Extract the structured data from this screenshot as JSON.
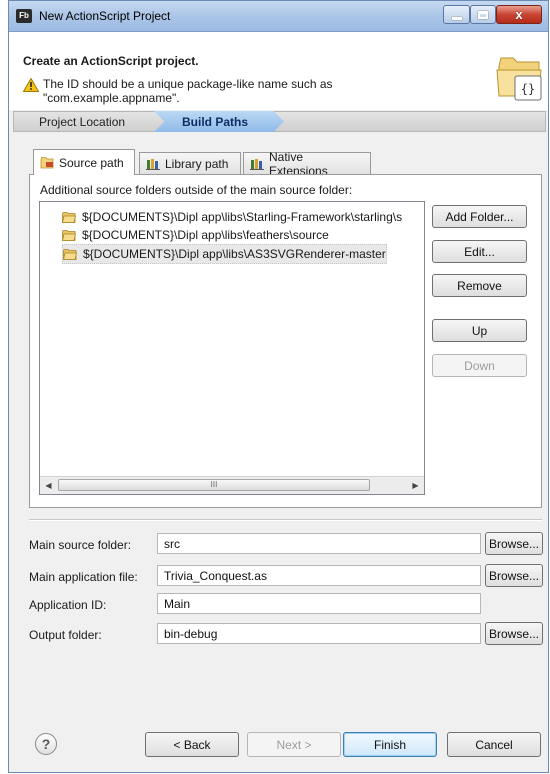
{
  "window": {
    "app_badge": "Fb",
    "title": "New ActionScript Project",
    "close_glyph": "x"
  },
  "header": {
    "title": "Create an ActionScript project.",
    "message": "The ID should be a unique package-like name such as \"com.example.appname\".",
    "banner_glyph": "{}"
  },
  "breadcrumb": {
    "items": [
      {
        "label": "Project Location"
      },
      {
        "label": "Build Paths"
      }
    ],
    "active_index": 1
  },
  "tabs": [
    {
      "label": "Source path",
      "icon": "source-path-icon"
    },
    {
      "label": "Library path",
      "icon": "library-icon"
    },
    {
      "label": "Native Extensions",
      "icon": "native-extension-icon"
    }
  ],
  "source_panel": {
    "label": "Additional source folders outside of the main source folder:",
    "folders": [
      {
        "path": "${DOCUMENTS}\\Dipl app\\libs\\Starling-Framework\\starling\\s"
      },
      {
        "path": "${DOCUMENTS}\\Dipl app\\libs\\feathers\\source"
      },
      {
        "path": "${DOCUMENTS}\\Dipl app\\libs\\AS3SVGRenderer-master"
      }
    ],
    "selected_index": 2,
    "scroll_thumb_grip": "III",
    "buttons": {
      "add_folder": "Add Folder...",
      "edit": "Edit...",
      "remove": "Remove",
      "up": "Up",
      "down": "Down"
    }
  },
  "form": {
    "main_source_folder": {
      "label": "Main source folder:",
      "value": "src"
    },
    "main_application_file": {
      "label": "Main application file:",
      "value": "Trivia_Conquest.as"
    },
    "application_id": {
      "label": "Application ID:",
      "value": "Main"
    },
    "output_folder": {
      "label": "Output folder:",
      "value": "bin-debug"
    },
    "browse_label": "Browse..."
  },
  "footer": {
    "help_glyph": "?",
    "back": "< Back",
    "next": "Next >",
    "finish": "Finish",
    "cancel": "Cancel"
  },
  "colors": {
    "accent": "#3c7fb1",
    "titlebar": "#a9c4e6",
    "breadcrumb_active": "#8fbbe8",
    "warning": "#f3c318"
  }
}
